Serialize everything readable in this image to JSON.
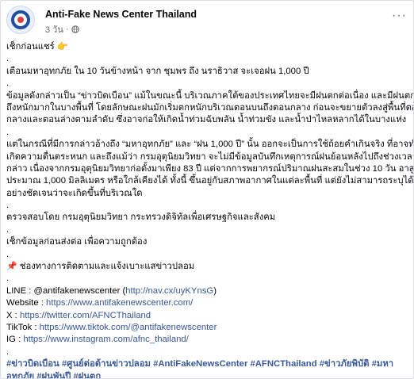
{
  "header": {
    "page_name": "Anti-Fake News Center Thailand",
    "time": "3 วัน",
    "separator": "·"
  },
  "post": {
    "l1": "เช็กก่อนแชร์ 👉",
    "d1": ".",
    "l2": "เตือนมหาอุทกภัย ใน 10 วันข้างหน้า จาก ชุมพร ถึง นราธิวาส จะเจอฝน 1,000 ปี",
    "d2": ".",
    "p1a": "ข้อมูลดังกล่าวเป็น “ข่าวบิดเบือน” แม้ในขณะนี้ บริเวณภาคใต้ของประเทศไทยจะมีฝนตกต่อเนื่อง และมีฝนตกหนัก",
    "p1b": "ถึงหนักมากในบางพื้นที่ โดยลักษณะฝนมักเริ่มตกหนักบริเวณตอนบนถึงตอนกลาง ก่อนจะขยายตัวลงสู่พื้นที่ตอน",
    "p1c": "กลางและตอนล่างตามลำดับ ซึ่งอาจก่อให้เกิดน้ำท่วมฉับพลัน น้ำท่วมขัง และน้ำป่าไหลหลากได้ในบางแห่ง",
    "d3": ".",
    "p2a": "แต่ในกรณีที่มีการกล่าวอ้างถึง “มหาอุทกภัย” และ “ฝน 1,000 ปี” นั้น ออกจะเป็นการใช้ถ้อยคำเกินจริง ที่อาจทำให",
    "p2b": "เกิดความตื่นตระหนก และถึงแม้ว่า กรมอุตุนิยมวิทยา จะไม่มีข้อมูลบันทึกเหตุการณ์ฝนย้อนหลังไปถึงช่วงเวลาดัง",
    "p2c": "กล่าว เนื่องจากกรมอุตุนิยมวิทยาก่อตั้งมาเพียง 83 ปี แต่จากการพยากรณ์ปริมาณฝนสะสมในช่วง 10 วัน อาสูงถึง",
    "p2d": "ประมาณ 1,000 มิลลิเมตร หรือใกล้เคียงได้ ทั้งนี้ ขึ้นอยู่กับสภาพอากาศในแต่ละพื้นที่ แต่ยังไม่สามารถระบุได้",
    "p2e": "อย่างชัดเจนว่าจะเกิดขึ้นที่บริเวณใด",
    "d4": ".",
    "l3": "ตรวจสอบโดย กรมอุตุนิยมวิทยา กระทรวงดิจิทัลเพื่อเศรษฐกิจและสังคม",
    "d5": ".",
    "l4": "เช็กข้อมูลก่อนส่งต่อ เพื่อความถูกต้อง",
    "d6": ".",
    "l5_icon": "📌",
    "l5": "ช่องทางการติดตามและแจ้งเบาะแสข่าวปลอม",
    "d7": ".",
    "line_label": "LINE : @antifakenewscenter (",
    "line_url": "http://nav.cx/uyKYnsG",
    "line_close": ")",
    "web_label": "Website : ",
    "web_url": "https://www.antifakenewscenter.com/",
    "x_label": "X : ",
    "x_url": "https://twitter.com/AFNCThailand",
    "tiktok_label": "TikTok : ",
    "tiktok_url": "https://www.tiktok.com/@antifakenewscenter",
    "ig_label": "IG : ",
    "ig_url": "https://www.instagram.com/afnc_thailand/",
    "d8": ".",
    "tags1": "#ข่าวบิดเบือน #ศูนย์ต่อต้านข่าวปลอม #AntiFakeNewsCenter #AFNCThailand #ข่าวภัยพิบัติ #มหา",
    "tags2": "อุทกภัย #ฝนพันปี #ฝนตก"
  }
}
